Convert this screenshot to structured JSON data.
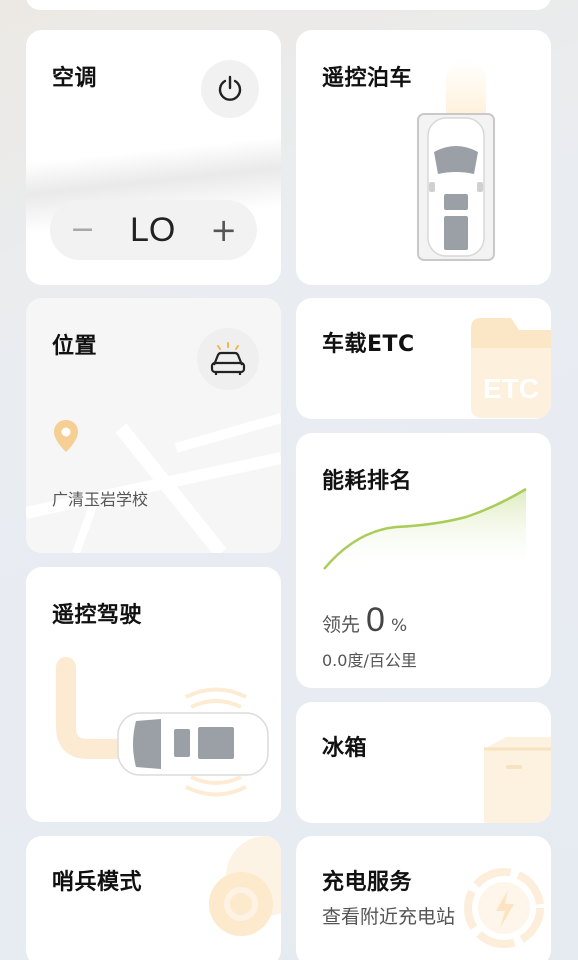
{
  "ac": {
    "title": "空调",
    "power_icon": "power-icon",
    "minus_label": "−",
    "value": "LO",
    "plus_label": "+"
  },
  "parking": {
    "title": "遥控泊车",
    "icon": "car-top-view-icon"
  },
  "location": {
    "title": "位置",
    "car_icon": "car-front-icon",
    "pin_icon": "location-pin-icon",
    "address": "广清玉岩学校"
  },
  "etc": {
    "title": "车载ETC",
    "decor_text": "ETC"
  },
  "energy": {
    "title": "能耗排名",
    "lead_label": "领先",
    "lead_value": "0",
    "lead_unit": "%",
    "consumption": "0.0度/百公里"
  },
  "remote_drive": {
    "title": "遥控驾驶",
    "icon": "car-side-top-view-icon"
  },
  "fridge": {
    "title": "冰箱",
    "icon": "box-icon"
  },
  "sentry": {
    "title": "哨兵模式",
    "icon": "ring-icon"
  },
  "charging": {
    "title": "充电服务",
    "subtitle": "查看附近充电站",
    "icon": "lightning-icon"
  },
  "colors": {
    "accent_orange": "#f5c98a",
    "chart_green": "#a9cc5a",
    "card_bg": "#ffffff"
  }
}
